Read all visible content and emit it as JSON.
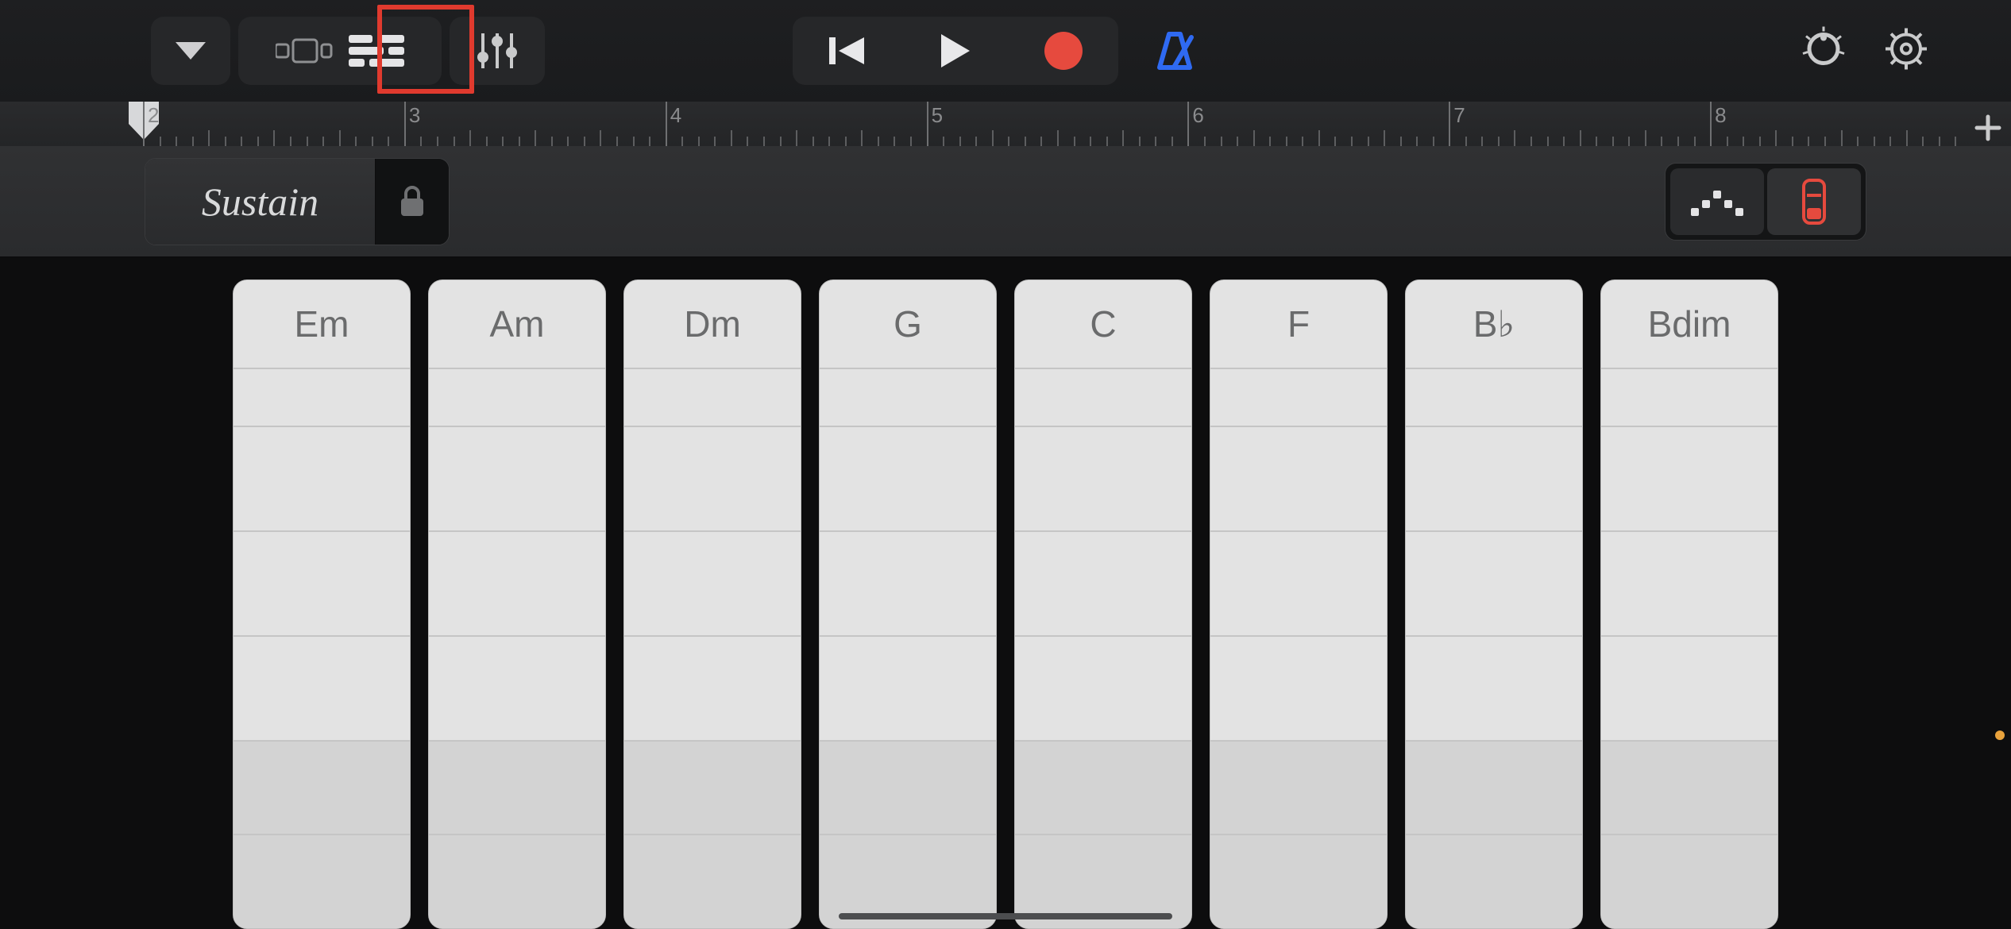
{
  "subheader": {
    "sustain_label": "Sustain"
  },
  "ruler": {
    "bars": [
      "2",
      "3",
      "4",
      "5",
      "6",
      "7",
      "8"
    ]
  },
  "chords": [
    "Em",
    "Am",
    "Dm",
    "G",
    "C",
    "F",
    "B♭",
    "Bdim"
  ]
}
